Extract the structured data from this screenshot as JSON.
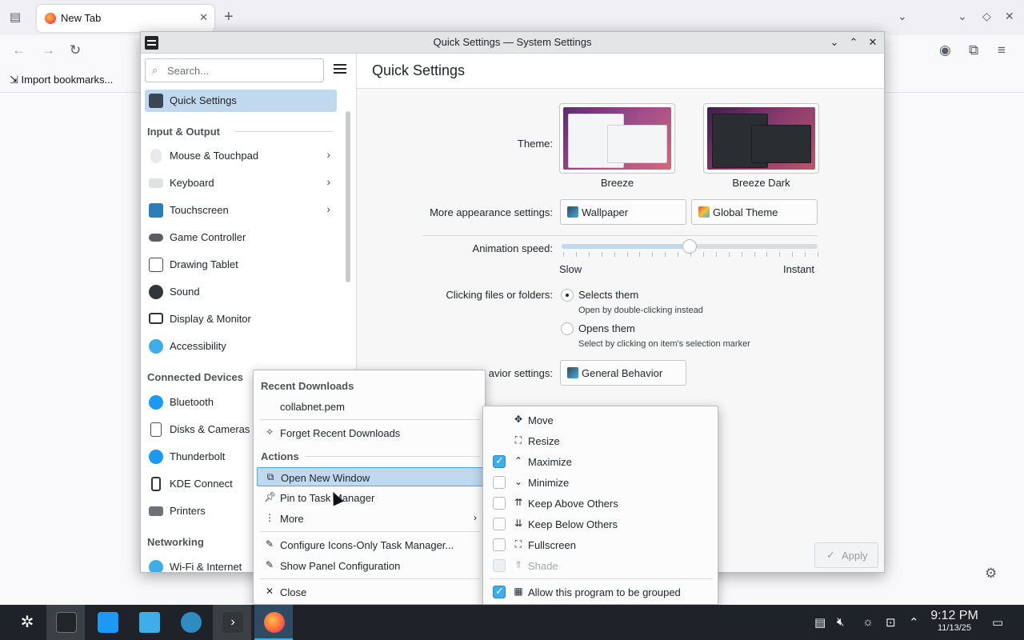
{
  "browser": {
    "tab_title": "New Tab",
    "tab_close": "✕",
    "new_tab": "+",
    "bookmark_label": "Import bookmarks..."
  },
  "window": {
    "title": "Quick Settings — System Settings"
  },
  "sidebar": {
    "search_placeholder": "Search...",
    "quick_settings": "Quick Settings",
    "sections": {
      "input_output": "Input & Output",
      "connected_devices": "Connected Devices",
      "networking": "Networking"
    },
    "items": [
      "Mouse & Touchpad",
      "Keyboard",
      "Touchscreen",
      "Game Controller",
      "Drawing Tablet",
      "Sound",
      "Display & Monitor",
      "Accessibility",
      "Bluetooth",
      "Disks & Cameras",
      "Thunderbolt",
      "KDE Connect",
      "Printers",
      "Wi-Fi & Internet"
    ]
  },
  "main": {
    "page_title": "Quick Settings",
    "theme_label": "Theme:",
    "themes": [
      "Breeze",
      "Breeze Dark"
    ],
    "more_appearance_label": "More appearance settings:",
    "wallpaper_button": "Wallpaper",
    "global_theme_button": "Global Theme",
    "animation_label": "Animation speed:",
    "animation_value": 0.5,
    "slow_label": "Slow",
    "instant_label": "Instant",
    "clicking_label": "Clicking files or folders:",
    "radio_selects": "Selects them",
    "radio_selects_hint": "Open by double-clicking instead",
    "radio_opens": "Opens them",
    "radio_opens_hint": "Select by clicking on item's selection marker",
    "behavior_label_partial": "avior settings:",
    "general_behavior_button": "General Behavior",
    "apply_button": "Apply"
  },
  "context_menu": {
    "recent_downloads_header": "Recent Downloads",
    "recent_file": "collabnet.pem",
    "forget_downloads": "Forget Recent Downloads",
    "actions_header": "Actions",
    "open_new_window": "Open New Window",
    "pin_to_task_manager": "Pin to Task Manager",
    "more": "More",
    "configure": "Configure Icons-Only Task Manager...",
    "show_panel_config": "Show Panel Configuration",
    "close": "Close"
  },
  "submenu": {
    "move": "Move",
    "resize": "Resize",
    "maximize": "Maximize",
    "minimize": "Minimize",
    "keep_above": "Keep Above Others",
    "keep_below": "Keep Below Others",
    "fullscreen": "Fullscreen",
    "shade": "Shade",
    "allow_grouped": "Allow this program to be grouped"
  },
  "taskbar": {
    "time": "9:12 PM",
    "date": "11/13/25"
  }
}
